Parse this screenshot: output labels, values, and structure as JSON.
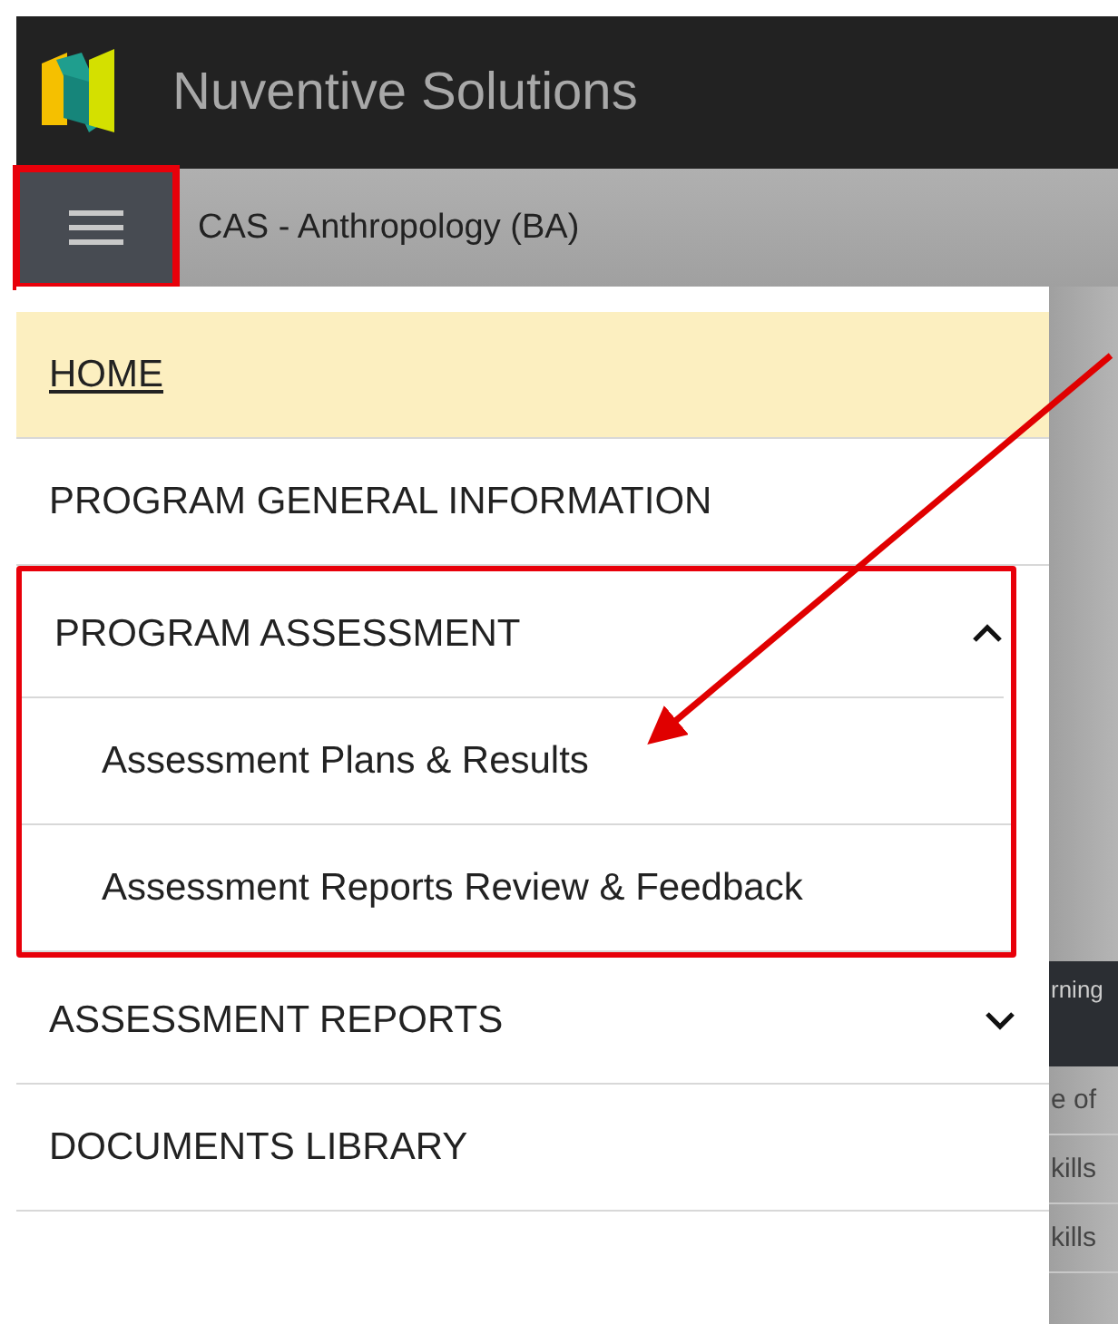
{
  "header": {
    "title": "Nuventive Solutions"
  },
  "subbar": {
    "program": "CAS - Anthropology (BA)"
  },
  "menu": [
    {
      "label": "HOME",
      "selected": true
    },
    {
      "label": "PROGRAM GENERAL INFORMATION",
      "selected": false
    },
    {
      "label": "PROGRAM ASSESSMENT",
      "selected": false,
      "expanded": true,
      "highlighted": true,
      "children": [
        {
          "label": "Assessment Plans & Results"
        },
        {
          "label": "Assessment Reports Review & Feedback"
        }
      ]
    },
    {
      "label": "ASSESSMENT REPORTS",
      "selected": false,
      "expanded": false
    },
    {
      "label": "DOCUMENTS LIBRARY",
      "selected": false
    }
  ],
  "background_page": {
    "header_text": "rning",
    "rows": [
      "e of",
      "kills",
      "kills"
    ]
  }
}
